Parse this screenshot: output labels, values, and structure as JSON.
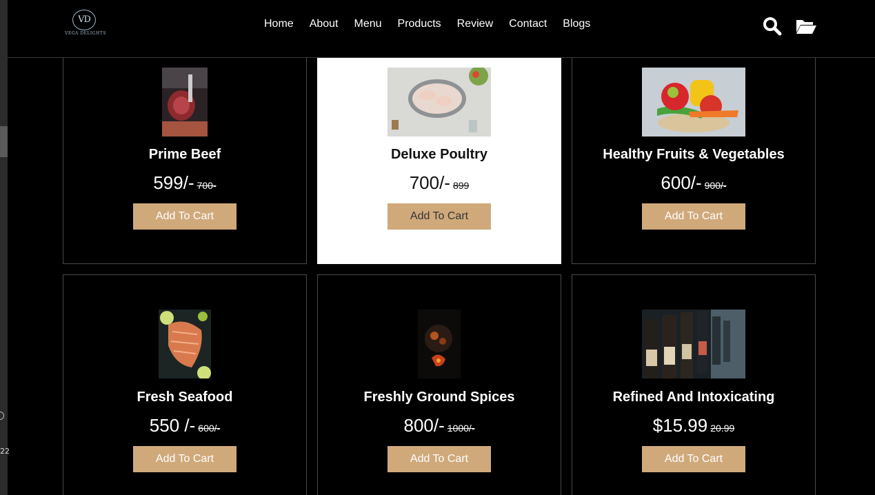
{
  "brand": {
    "monogram": "VD",
    "name": "VEGA DELIGHTS"
  },
  "nav": [
    "Home",
    "About",
    "Menu",
    "Products",
    "Review",
    "Contact",
    "Blogs"
  ],
  "icons": {
    "search": "search-icon",
    "cart": "folder-open-icon"
  },
  "accent_color": "#d0a97b",
  "edge_number": "22",
  "products": [
    {
      "title": "Prime Beef",
      "price": "599/-",
      "old_price": "700-",
      "button": "Add To Cart"
    },
    {
      "title": "Deluxe Poultry",
      "price": "700/-",
      "old_price": "899",
      "button": "Add To Cart"
    },
    {
      "title": "Healthy Fruits & Vegetables",
      "price": "600/-",
      "old_price": "900/-",
      "button": "Add To Cart"
    },
    {
      "title": "Fresh Seafood",
      "price": "550 /-",
      "old_price": "600/-",
      "button": "Add To Cart"
    },
    {
      "title": "Freshly Ground Spices",
      "price": "800/-",
      "old_price": "1000/-",
      "button": "Add To Cart"
    },
    {
      "title": "Refined And Intoxicating",
      "price": "$15.99",
      "old_price": "20.99",
      "button": "Add To Cart"
    }
  ]
}
